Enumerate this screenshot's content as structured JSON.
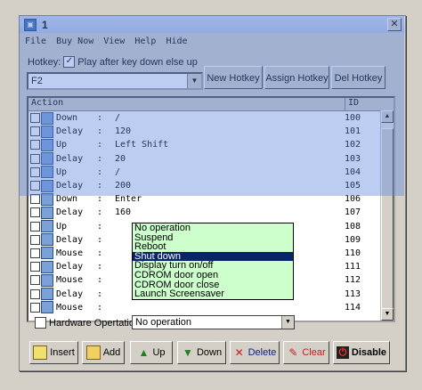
{
  "window": {
    "title": "1",
    "close_glyph": "✕"
  },
  "menu": [
    "File",
    "Buy Now",
    "View",
    "Help",
    "Hide"
  ],
  "hotkey": {
    "label": "Hotkey:",
    "checkbox_label": "Play after key down else up",
    "checked": true,
    "value": "F2"
  },
  "buttons": {
    "new_hotkey": "New Hotkey",
    "assign_hotkey": "Assign Hotkey",
    "del_hotkey": "Del Hotkey"
  },
  "list": {
    "headers": {
      "action": "Action",
      "id": "ID"
    },
    "rows": [
      {
        "action": "Down",
        "value": "/",
        "id": "100"
      },
      {
        "action": "Delay",
        "value": "120",
        "id": "101"
      },
      {
        "action": "Up",
        "value": "Left Shift",
        "id": "102"
      },
      {
        "action": "Delay",
        "value": "20",
        "id": "103"
      },
      {
        "action": "Up",
        "value": "/",
        "id": "104"
      },
      {
        "action": "Delay",
        "value": "200",
        "id": "105"
      },
      {
        "action": "Down",
        "value": "Enter",
        "id": "106"
      },
      {
        "action": "Delay",
        "value": "160",
        "id": "107"
      },
      {
        "action": "Up",
        "value": "",
        "id": "108"
      },
      {
        "action": "Delay",
        "value": "",
        "id": "109"
      },
      {
        "action": "Mouse",
        "value": "",
        "id": "110"
      },
      {
        "action": "Delay",
        "value": "",
        "id": "111"
      },
      {
        "action": "Mouse",
        "value": "",
        "id": "112"
      },
      {
        "action": "Delay",
        "value": "",
        "id": "113"
      },
      {
        "action": "Mouse",
        "value": "",
        "id": "114"
      }
    ],
    "colon": ":"
  },
  "dropdown": {
    "options": [
      "No operation",
      "Suspend",
      "Reboot",
      "Shut down",
      "Display turn on/off",
      "CDROM door open",
      "CDROM door close",
      "Launch Screensaver"
    ],
    "selected": "Shut down"
  },
  "hardware": {
    "label": "Hardware Opertation:",
    "value": "No operation"
  },
  "toolbar": {
    "insert": "Insert",
    "add": "Add",
    "up": "Up",
    "down": "Down",
    "delete": "Delete",
    "clear": "Clear",
    "disable": "Disable"
  },
  "colors": {
    "overlay": "#5a82dc",
    "dropdown_bg": "#ccffcc",
    "selection": "#0a246a"
  }
}
